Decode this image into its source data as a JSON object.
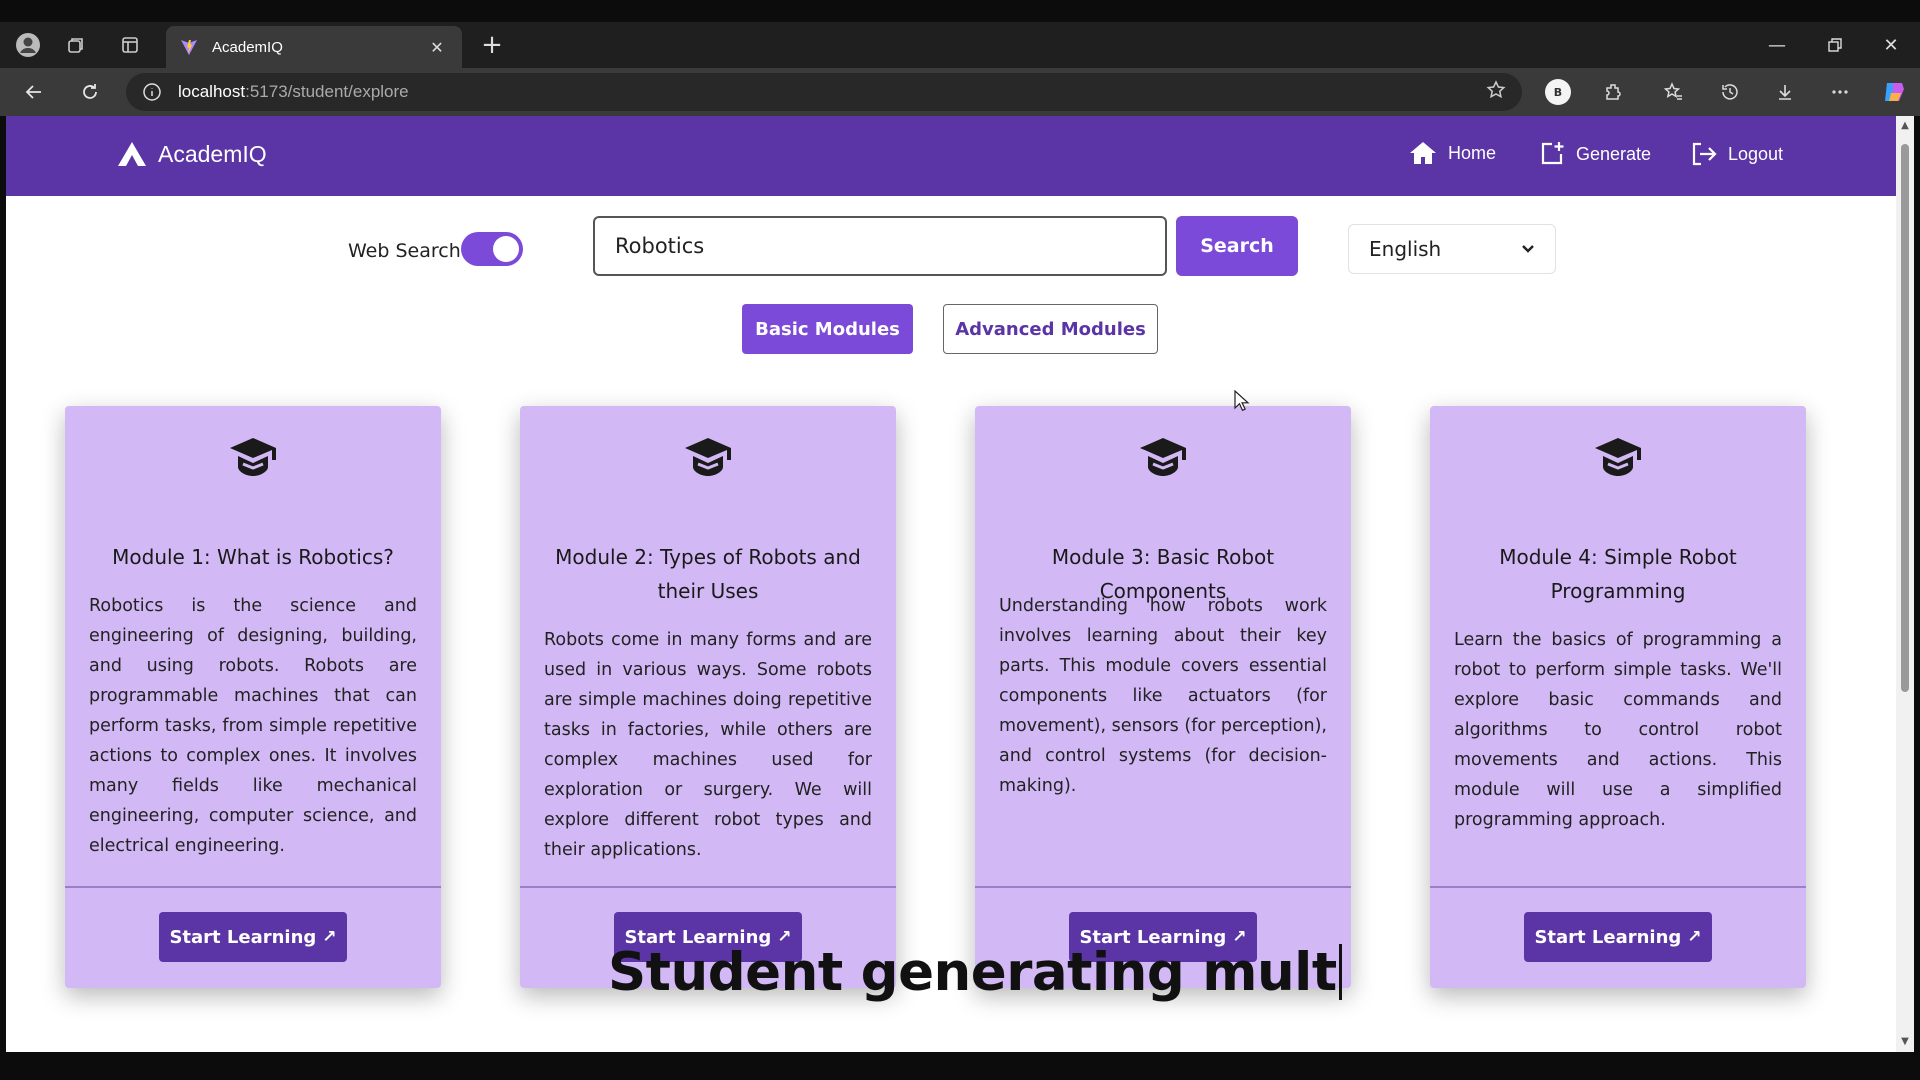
{
  "browser": {
    "tab_title": "AcademIQ",
    "url_host": "localhost",
    "url_path": ":5173/student/explore",
    "profile_initial": "B"
  },
  "app": {
    "brand": "AcademIQ",
    "nav": {
      "home": "Home",
      "generate": "Generate",
      "logout": "Logout"
    }
  },
  "search": {
    "web_search_label": "Web Search",
    "web_search_enabled": true,
    "query": "Robotics",
    "button": "Search"
  },
  "language": {
    "selected": "English"
  },
  "module_tabs": {
    "basic": "Basic Modules",
    "advanced": "Advanced Modules",
    "active": "basic"
  },
  "modules": [
    {
      "title": "Module 1: What is Robotics?",
      "description": "Robotics is the science and engineering of designing, building, and using robots. Robots are programmable machines that can perform tasks, from simple repetitive actions to complex ones. It involves many fields like mechanical engineering, computer science, and electrical engineering.",
      "button": "Start Learning"
    },
    {
      "title": "Module 2: Types of Robots and their Uses",
      "description": "Robots come in many forms and are used in various ways. Some robots are simple machines doing repetitive tasks in factories, while others are complex machines used for exploration or surgery. We will explore different robot types and their applications.",
      "button": "Start Learning"
    },
    {
      "title": "Module 3: Basic Robot Components",
      "description": "Understanding how robots work involves learning about their key parts. This module covers essential components like actuators (for movement), sensors (for perception), and control systems (for decision-making).",
      "button": "Start Learning"
    },
    {
      "title": "Module 4: Simple Robot Programming",
      "description": "Learn the basics of programming a robot to perform simple tasks. We'll explore basic commands and algorithms to control robot movements and actions. This module will use a simplified programming approach.",
      "button": "Start Learning"
    }
  ],
  "overlay_caption": "Student generating mult",
  "colors": {
    "nav_purple": "#5b34a6",
    "accent_purple": "#7b4ad8",
    "card_lilac": "#d2b9f5"
  }
}
